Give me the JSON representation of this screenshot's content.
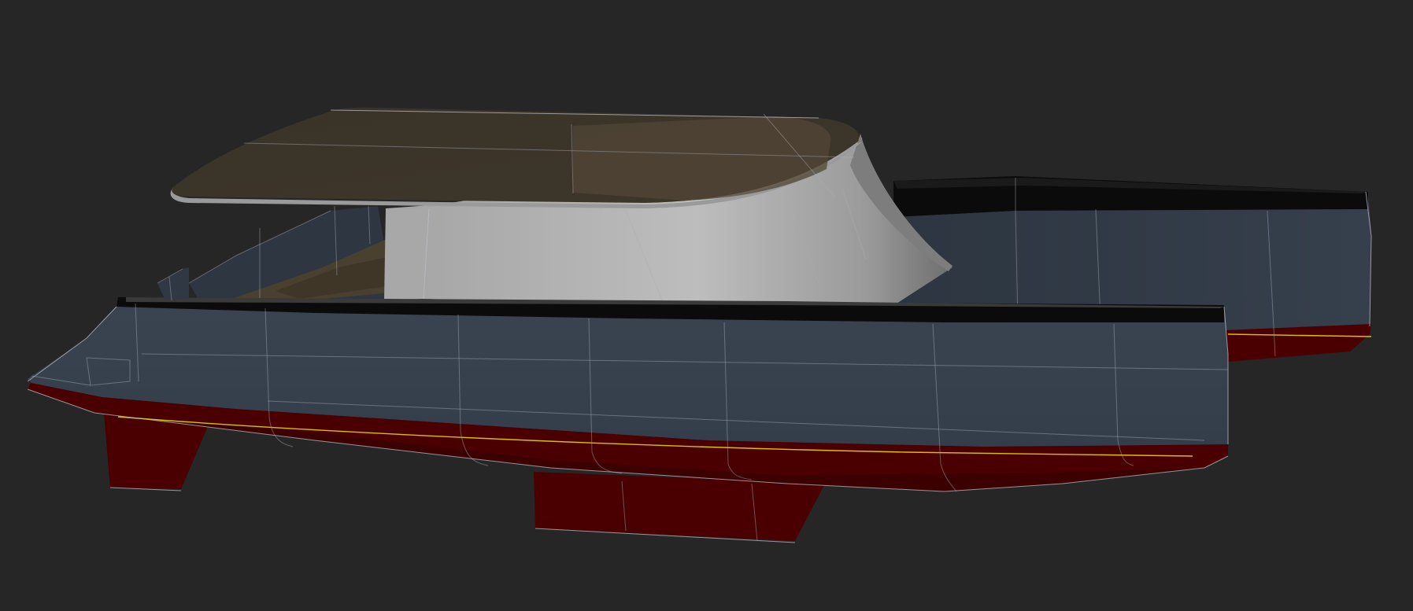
{
  "viewport": {
    "background_color": "#262626"
  },
  "model": {
    "colors": {
      "hull_topsides": "#37414d",
      "hull_topsides_far": "#2f3844",
      "antifouling": "#4a0000",
      "antifouling_dark": "#3c0000",
      "sheer_cap": "#0b0b0b",
      "hardtop": "#3f372c",
      "superstructure_light": "#b3b3b3",
      "superstructure_dark": "#777777",
      "cockpit_floor": "#4a4030",
      "edge_lines": "#b9bec6",
      "waterline": "#d8c100"
    }
  }
}
